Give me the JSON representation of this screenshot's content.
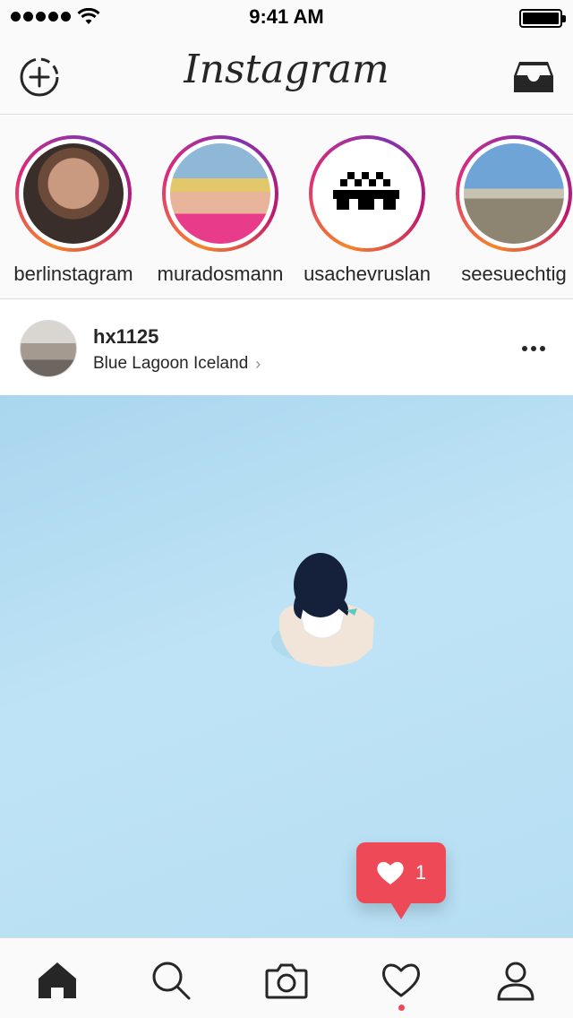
{
  "status_bar": {
    "time": "9:41 AM"
  },
  "nav": {
    "title": "Instagram"
  },
  "stories": [
    {
      "username": "berlinstagram",
      "avatar": "portrait-man"
    },
    {
      "username": "muradosmann",
      "avatar": "portrait-bandana"
    },
    {
      "username": "usachevruslan",
      "avatar": "pixel-art"
    },
    {
      "username": "seesuechtig",
      "avatar": "field-landscape"
    }
  ],
  "post": {
    "username": "hx1125",
    "location": "Blue Lagoon Iceland",
    "image": "woman-in-blue-lagoon"
  },
  "notification": {
    "likes": "1"
  },
  "tabs": [
    "home",
    "search",
    "camera",
    "activity",
    "profile"
  ],
  "colors": {
    "accent": "#ed4956",
    "text": "#262626",
    "border": "#dbdbdb",
    "bar": "#fafafa"
  }
}
